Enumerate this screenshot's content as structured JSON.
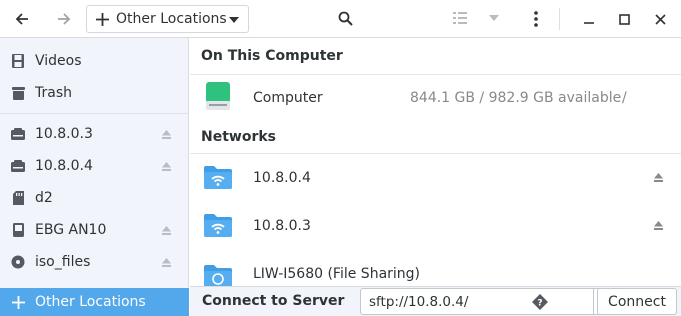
{
  "header": {
    "location_label": "Other Locations",
    "icons": [
      "back-arrow-icon",
      "forward-arrow-icon",
      "plus-icon",
      "caret-down-icon",
      "search-icon",
      "list-view-icon",
      "kebab-menu-icon",
      "minimize-icon",
      "maximize-icon",
      "close-icon"
    ]
  },
  "sidebar": {
    "items": [
      {
        "label": "Videos",
        "icon": "film-icon"
      },
      {
        "label": "Trash",
        "icon": "trash-icon"
      },
      {
        "label": "10.8.0.3",
        "icon": "network-drive-icon",
        "eject": true
      },
      {
        "label": "10.8.0.4",
        "icon": "network-drive-icon",
        "eject": true
      },
      {
        "label": "d2",
        "icon": "sd-card-icon",
        "eject": false
      },
      {
        "label": "EBG AN10",
        "icon": "drive-icon",
        "eject": true
      },
      {
        "label": "iso_files",
        "icon": "disc-icon",
        "eject": true
      }
    ],
    "other_locations": "Other Locations"
  },
  "main": {
    "on_this_computer": "On This Computer",
    "computer": {
      "label": "Computer",
      "detail": "844.1 GB / 982.9 GB available",
      "path": "/"
    },
    "networks": "Networks",
    "network_items": [
      {
        "label": "10.8.0.4",
        "eject": true
      },
      {
        "label": "10.8.0.3",
        "eject": true
      },
      {
        "label": "LIW-I5680 (File Sharing)",
        "eject": false
      }
    ]
  },
  "footer": {
    "connect_label": "Connect to Server",
    "server_value": "sftp://10.8.0.4/",
    "connect_button": "Connect"
  },
  "colors": {
    "accent": "#52a8ea",
    "sidebar_bg": "#f1f4fb",
    "folder_blue": "#3f9ee6",
    "drive_green": "#2ec27e"
  }
}
